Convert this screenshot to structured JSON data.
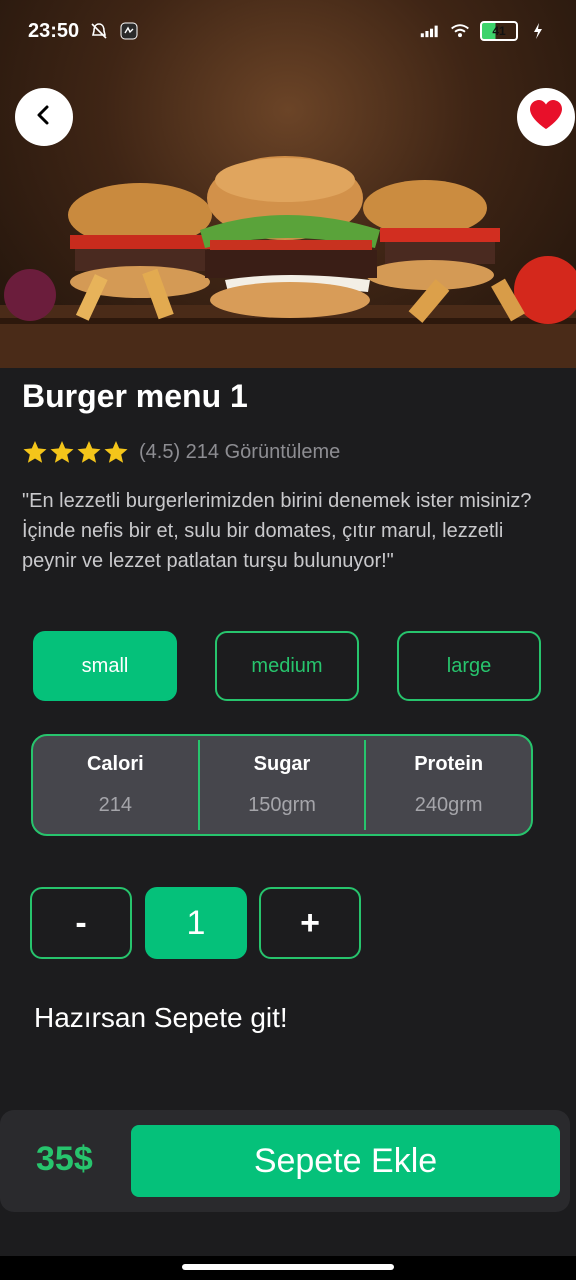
{
  "status_bar": {
    "time": "23:50",
    "battery": "41",
    "icons": [
      "bell-off-icon",
      "app-icon",
      "signal-icon",
      "wifi-icon",
      "battery-icon",
      "charging-icon"
    ]
  },
  "header": {
    "back_icon": "chevron-left-icon",
    "favorite_icon": "heart-icon",
    "favorite_color": "#e8102a"
  },
  "product": {
    "title": "Burger menu 1",
    "rating_stars": 4,
    "rating_text": "(4.5) 214 Görüntüleme",
    "description": "\"En lezzetli burgerlerimizden birini denemek ister misiniz? İçinde nefis bir et, sulu bir domates, çıtır marul, lezzetli peynir ve lezzet patlatan turşu bulunuyor!\""
  },
  "sizes": [
    {
      "label": "small",
      "selected": true
    },
    {
      "label": "medium",
      "selected": false
    },
    {
      "label": "large",
      "selected": false
    }
  ],
  "nutrition": [
    {
      "label": "Calori",
      "value": "214"
    },
    {
      "label": "Sugar",
      "value": "150grm"
    },
    {
      "label": "Protein",
      "value": "240grm"
    }
  ],
  "quantity": {
    "minus_label": "-",
    "value": "1",
    "plus_label": "+"
  },
  "hint": "Hazırsan Sepete git!",
  "checkout": {
    "price": "35$",
    "add_label": "Sepete Ekle"
  },
  "colors": {
    "accent": "#05c17a",
    "accent_border": "#27c46d",
    "background": "#1c1c1e",
    "star": "#f4c51a"
  }
}
